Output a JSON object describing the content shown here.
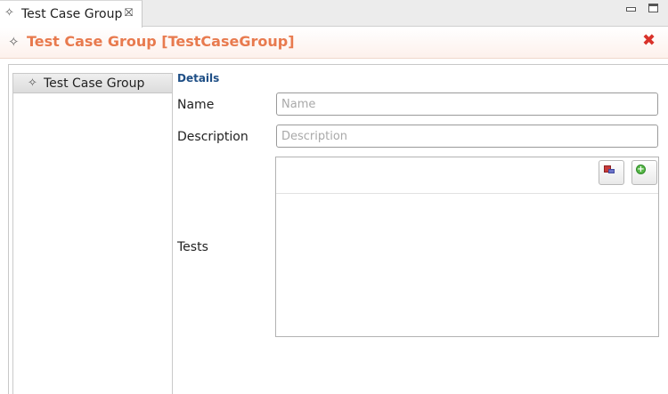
{
  "tab": {
    "label": "Test Case Group",
    "icon": "diamond-sparkle-icon",
    "close_symbol": "⛝"
  },
  "window_controls": {
    "minimize": "minimize-icon",
    "maximize": "maximize-icon"
  },
  "editor": {
    "title": "Test Case Group [TestCaseGroup]",
    "title_color": "#e87a4e",
    "close_color": "#d9322a"
  },
  "tree": {
    "items": [
      {
        "label": "Test Case Group"
      }
    ]
  },
  "details": {
    "section_title": "Details",
    "section_color": "#1f4f86",
    "name": {
      "label": "Name",
      "value": "",
      "placeholder": "Name"
    },
    "description": {
      "label": "Description",
      "value": "",
      "placeholder": "Description"
    },
    "tests": {
      "label": "Tests",
      "items": []
    }
  }
}
